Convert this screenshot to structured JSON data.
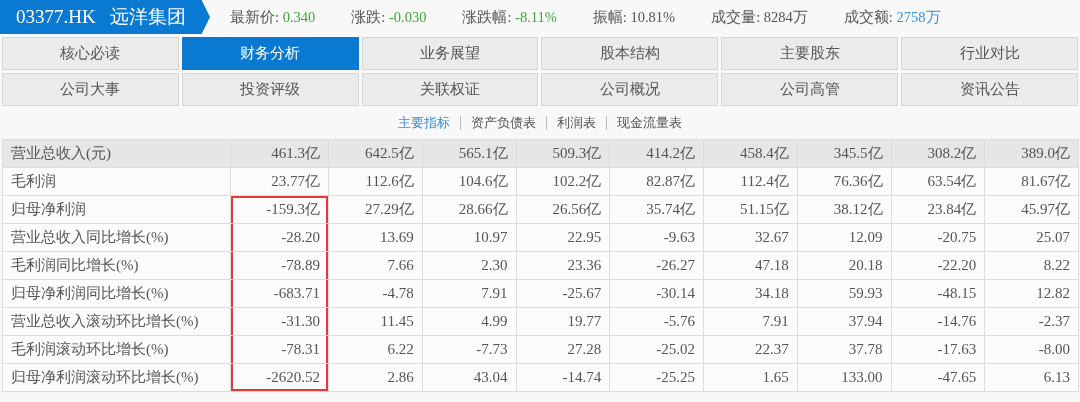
{
  "header": {
    "code": "03377.HK",
    "name": "远洋集团"
  },
  "stats": [
    {
      "label": "最新价:",
      "value": "0.340",
      "color": "#3aa83a"
    },
    {
      "label": "涨跌:",
      "value": "-0.030",
      "color": "#3aa83a"
    },
    {
      "label": "涨跌幅:",
      "value": "-8.11%",
      "color": "#3aa83a"
    },
    {
      "label": "振幅:",
      "value": "10.81%",
      "color": "#555555"
    },
    {
      "label": "成交量:",
      "value": "8284万",
      "color": "#555555"
    },
    {
      "label": "成交额:",
      "value": "2758万",
      "color": "#3b8ed8"
    }
  ],
  "tabs": [
    {
      "label": "核心必读",
      "selected": false
    },
    {
      "label": "财务分析",
      "selected": true
    },
    {
      "label": "业务展望",
      "selected": false
    },
    {
      "label": "股本结构",
      "selected": false
    },
    {
      "label": "主要股东",
      "selected": false
    },
    {
      "label": "行业对比",
      "selected": false
    },
    {
      "label": "公司大事",
      "selected": false
    },
    {
      "label": "投资评级",
      "selected": false
    },
    {
      "label": "关联权证",
      "selected": false
    },
    {
      "label": "公司概况",
      "selected": false
    },
    {
      "label": "公司高管",
      "selected": false
    },
    {
      "label": "资讯公告",
      "selected": false
    }
  ],
  "subnav": [
    {
      "label": "主要指标",
      "selected": true
    },
    {
      "label": "资产负债表",
      "selected": false
    },
    {
      "label": "利润表",
      "selected": false
    },
    {
      "label": "现金流量表",
      "selected": false
    }
  ],
  "table": {
    "rows": [
      {
        "label": "营业总收入(元)",
        "highlighted": false,
        "values": [
          "461.3亿",
          "642.5亿",
          "565.1亿",
          "509.3亿",
          "414.2亿",
          "458.4亿",
          "345.5亿",
          "308.2亿",
          "389.0亿"
        ]
      },
      {
        "label": "毛利润",
        "highlighted": false,
        "values": [
          "23.77亿",
          "112.6亿",
          "104.6亿",
          "102.2亿",
          "82.87亿",
          "112.4亿",
          "76.36亿",
          "63.54亿",
          "81.67亿"
        ]
      },
      {
        "label": "归母净利润",
        "highlighted": true,
        "values": [
          "-159.3亿",
          "27.29亿",
          "28.66亿",
          "26.56亿",
          "35.74亿",
          "51.15亿",
          "38.12亿",
          "23.84亿",
          "45.97亿"
        ]
      },
      {
        "label": "营业总收入同比增长(%)",
        "highlighted": true,
        "values": [
          "-28.20",
          "13.69",
          "10.97",
          "22.95",
          "-9.63",
          "32.67",
          "12.09",
          "-20.75",
          "25.07"
        ]
      },
      {
        "label": "毛利润同比增长(%)",
        "highlighted": true,
        "values": [
          "-78.89",
          "7.66",
          "2.30",
          "23.36",
          "-26.27",
          "47.18",
          "20.18",
          "-22.20",
          "8.22"
        ]
      },
      {
        "label": "归母净利润同比增长(%)",
        "highlighted": true,
        "values": [
          "-683.71",
          "-4.78",
          "7.91",
          "-25.67",
          "-30.14",
          "34.18",
          "59.93",
          "-48.15",
          "12.82"
        ]
      },
      {
        "label": "营业总收入滚动环比增长(%)",
        "highlighted": true,
        "values": [
          "-31.30",
          "11.45",
          "4.99",
          "19.77",
          "-5.76",
          "7.91",
          "37.94",
          "-14.76",
          "-2.37"
        ]
      },
      {
        "label": "毛利润滚动环比增长(%)",
        "highlighted": true,
        "values": [
          "-78.31",
          "6.22",
          "-7.73",
          "27.28",
          "-25.02",
          "22.37",
          "37.78",
          "-17.63",
          "-8.00"
        ]
      },
      {
        "label": "归母净利润滚动环比增长(%)",
        "highlighted": true,
        "values": [
          "-2620.52",
          "2.86",
          "43.04",
          "-14.74",
          "-25.25",
          "1.65",
          "133.00",
          "-47.65",
          "6.13"
        ]
      }
    ]
  }
}
